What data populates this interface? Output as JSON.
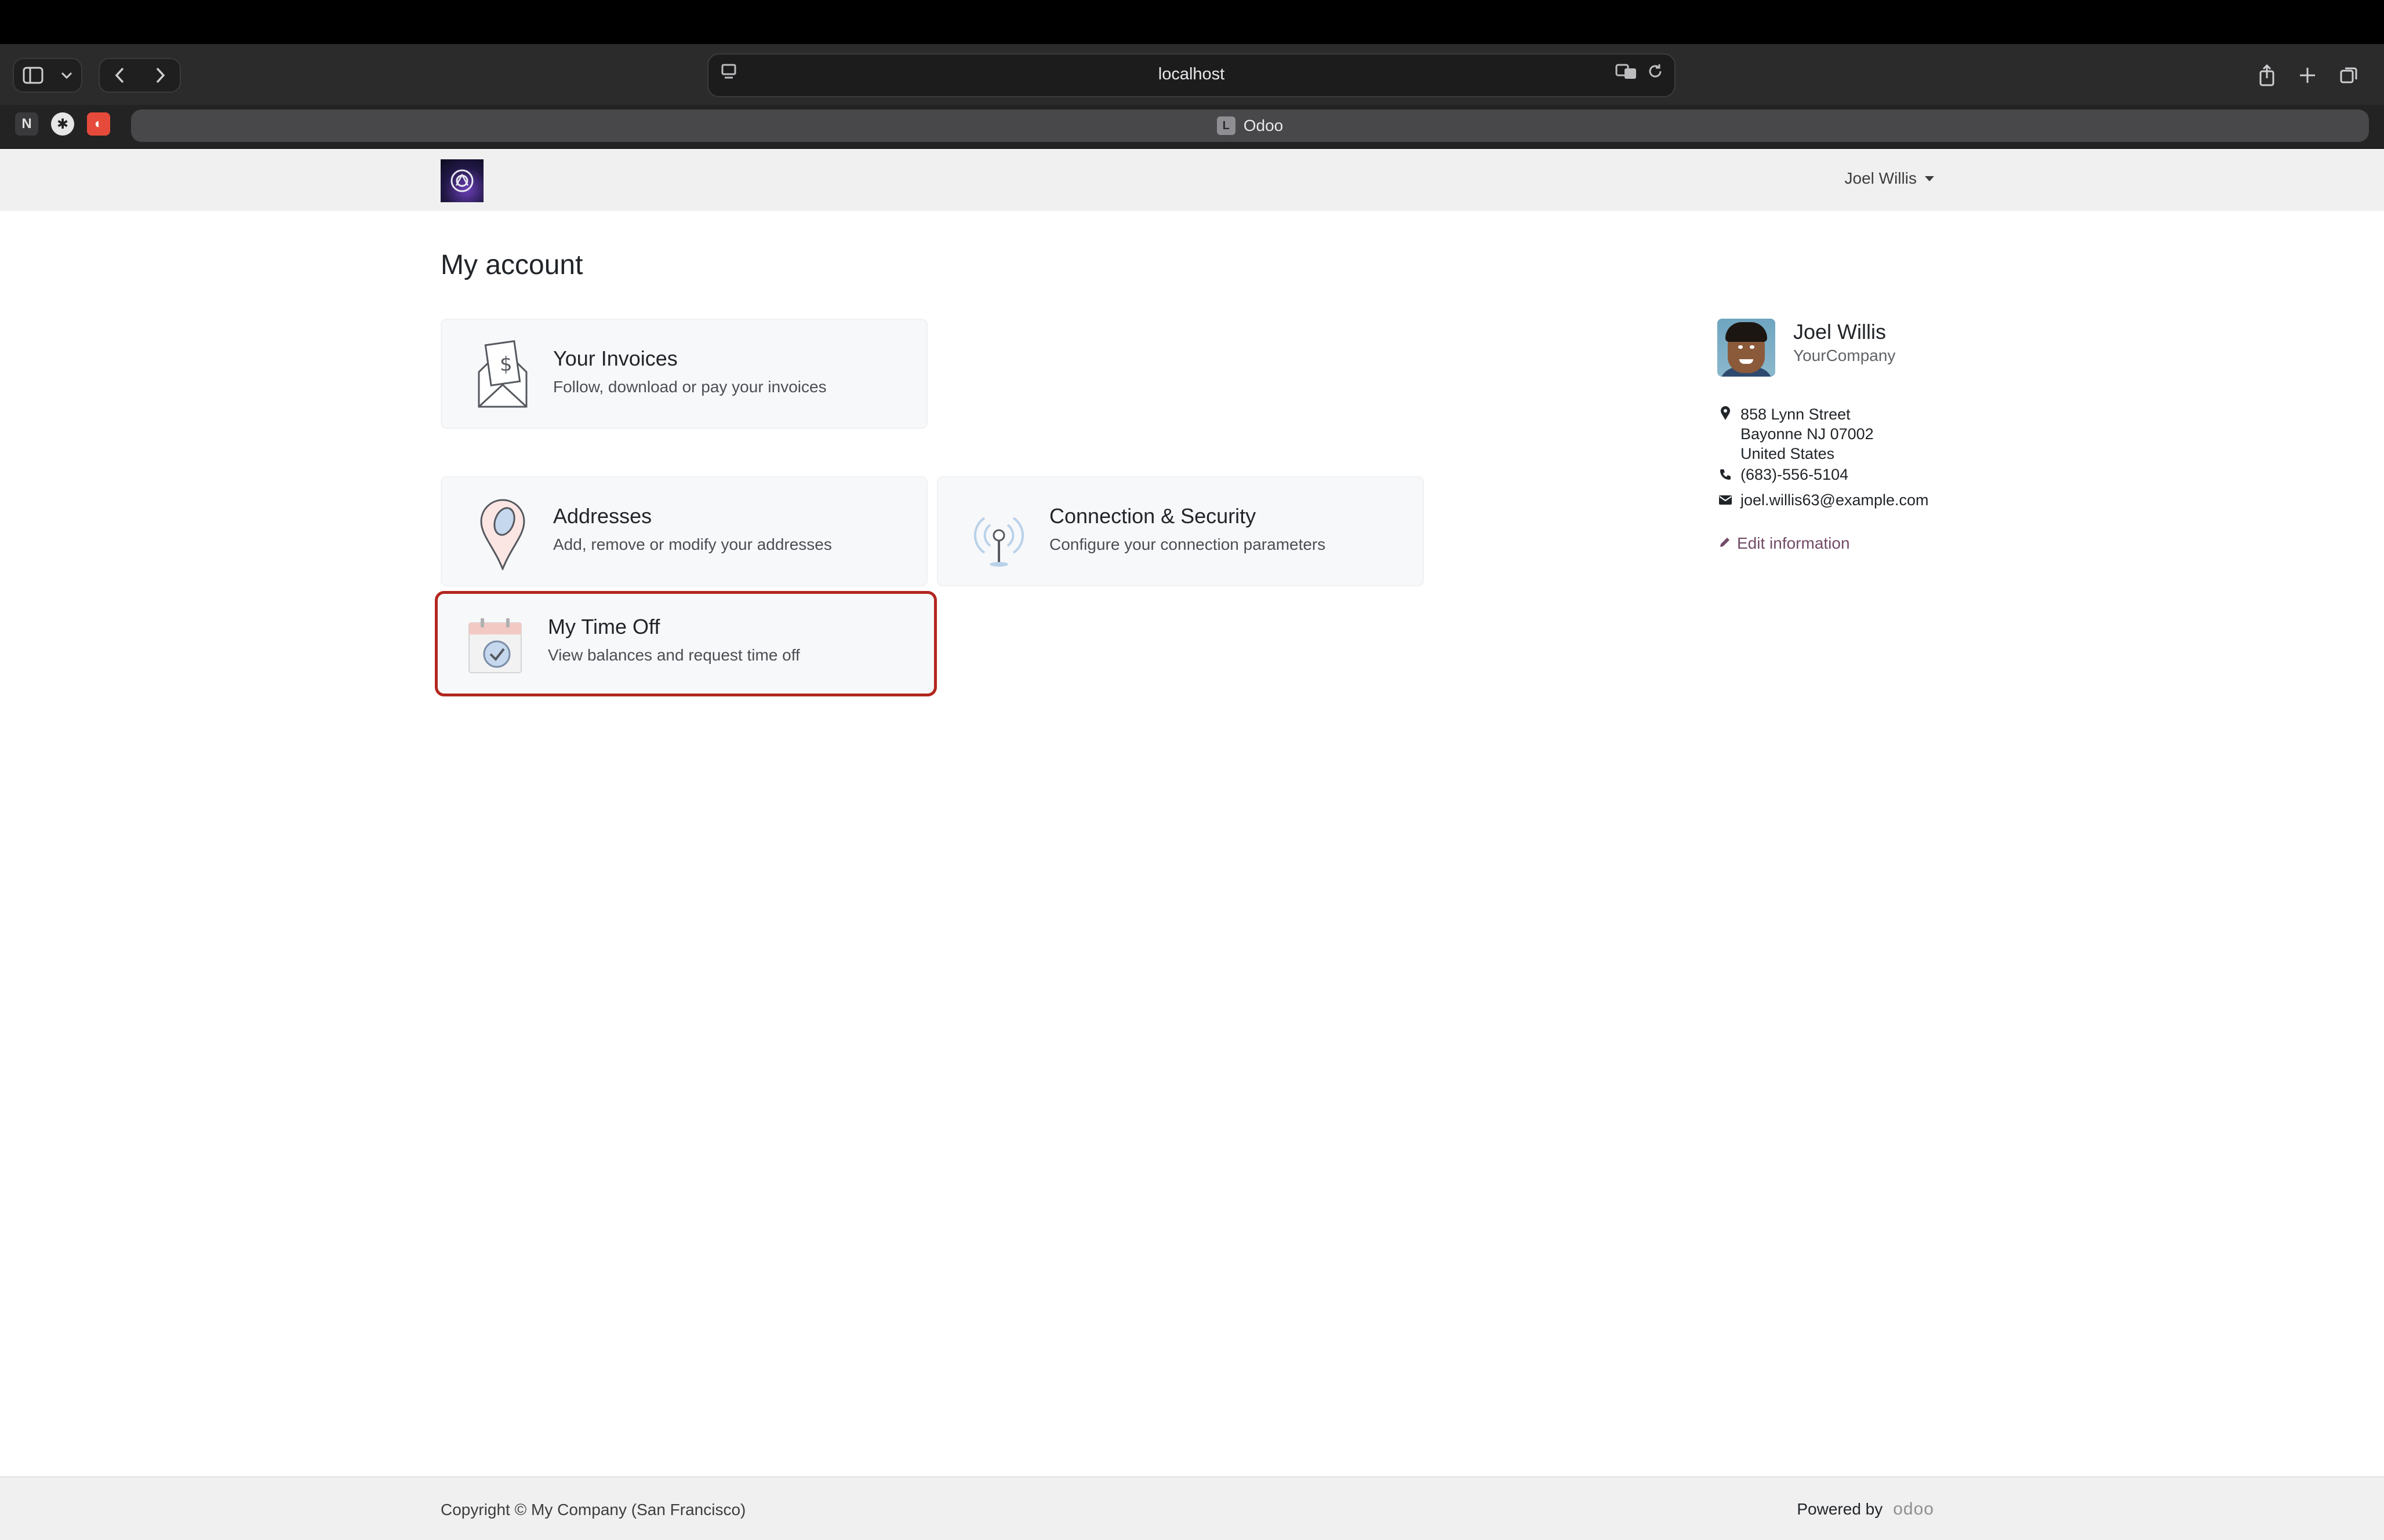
{
  "browser": {
    "url": "localhost",
    "tab_title": "Odoo",
    "tab_favicon_letter": "L"
  },
  "header": {
    "user_name": "Joel Willis"
  },
  "main": {
    "title": "My account",
    "cards": [
      {
        "title": "Your Invoices",
        "desc": "Follow, download or pay your invoices",
        "icon": "invoice-envelope-icon"
      },
      {
        "title": "Addresses",
        "desc": "Add, remove or modify your addresses",
        "icon": "map-pin-icon"
      },
      {
        "title": "Connection & Security",
        "desc": "Configure your connection parameters",
        "icon": "antenna-icon"
      },
      {
        "title": "My Time Off",
        "desc": "View balances and request time off",
        "icon": "calendar-check-icon"
      }
    ]
  },
  "profile": {
    "name": "Joel Willis",
    "company": "YourCompany",
    "address_lines": [
      "858 Lynn Street",
      "Bayonne NJ 07002",
      "United States"
    ],
    "phone": "(683)-556-5104",
    "email": "joel.willis63@example.com",
    "edit_label": "Edit information"
  },
  "footer": {
    "copyright": "Copyright © My Company (San Francisco)",
    "powered_by": "Powered by",
    "brand": "odoo"
  },
  "colors": {
    "selected_border": "#b3261e",
    "odoo_purple": "#714b67"
  }
}
